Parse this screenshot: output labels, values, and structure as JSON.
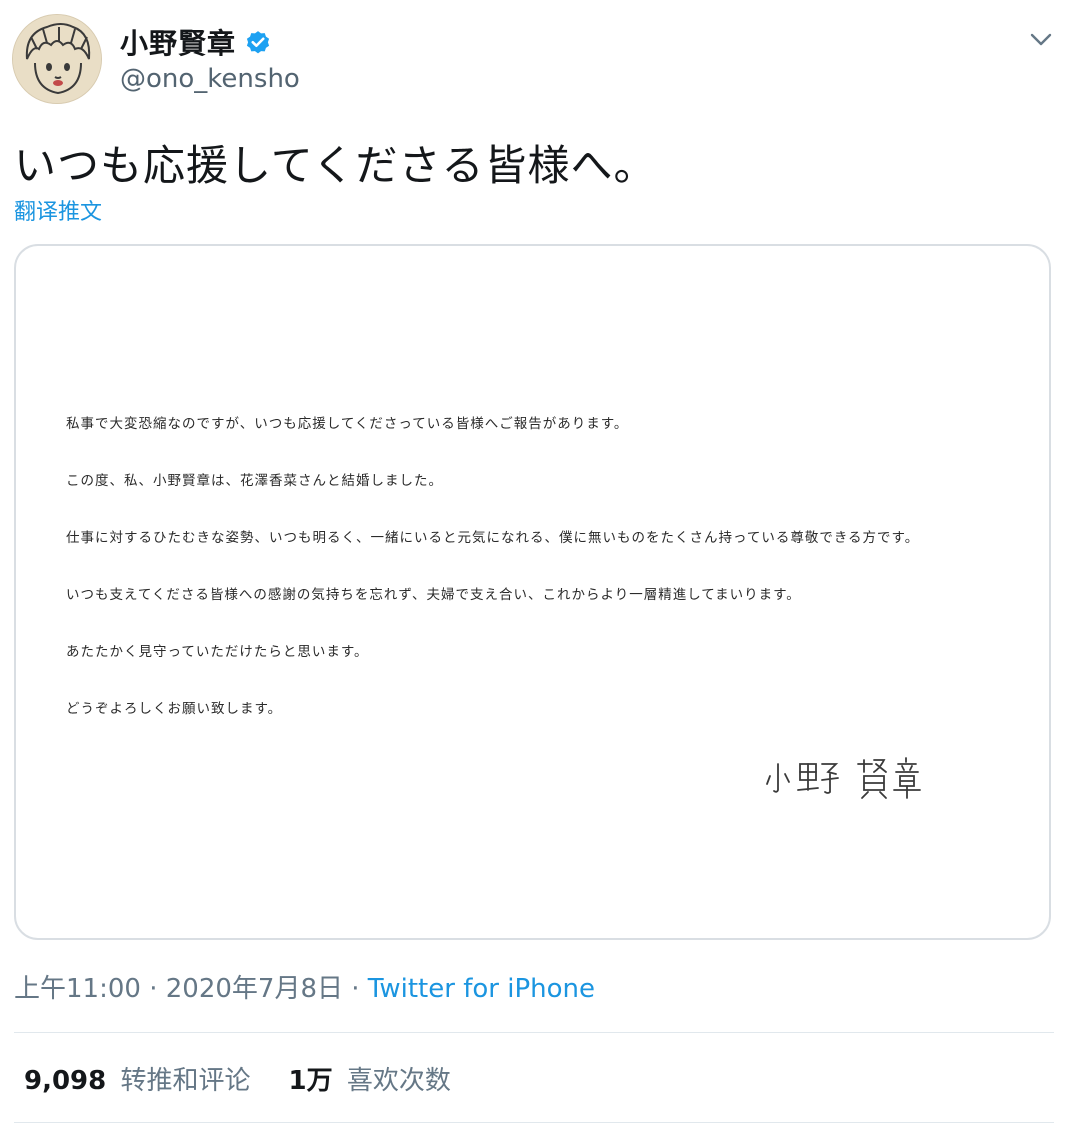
{
  "user": {
    "display_name": "小野賢章",
    "handle": "@ono_kensho",
    "verified": true,
    "avatar": "cartoon-face-avatar",
    "icons": {
      "verified": "verified-badge-icon",
      "menu": "chevron-down-icon"
    }
  },
  "tweet": {
    "text": "いつも応援してくださる皆様へ。",
    "translate_label": "翻译推文"
  },
  "media": {
    "type": "letter-image",
    "lines": [
      "私事で大変恐縮なのですが、いつも応援してくださっている皆様へご報告があります。",
      "この度、私、小野賢章は、花澤香菜さんと結婚しました。",
      "仕事に対するひたむきな姿勢、いつも明るく、一緒にいると元気になれる、僕に無いものをたくさん持っている尊敬できる方です。",
      "いつも支えてくださる皆様への感謝の気持ちを忘れず、夫婦で支え合い、これからより一層精進してまいります。",
      "あたたかく見守っていただけたらと思います。",
      "どうぞよろしくお願い致します。"
    ],
    "signature": "小野 賢章"
  },
  "meta": {
    "time": "上午11:00",
    "separator": "·",
    "date": "2020年7月8日",
    "source": "Twitter for iPhone"
  },
  "stats": {
    "retweets_count": "9,098",
    "retweets_label": "转推和评论",
    "likes_count": "1万",
    "likes_label": "喜欢次数"
  },
  "colors": {
    "link": "#1b95e0",
    "verified": "#1da1f2",
    "secondary_text": "#657786",
    "border": "#d9dee3"
  }
}
